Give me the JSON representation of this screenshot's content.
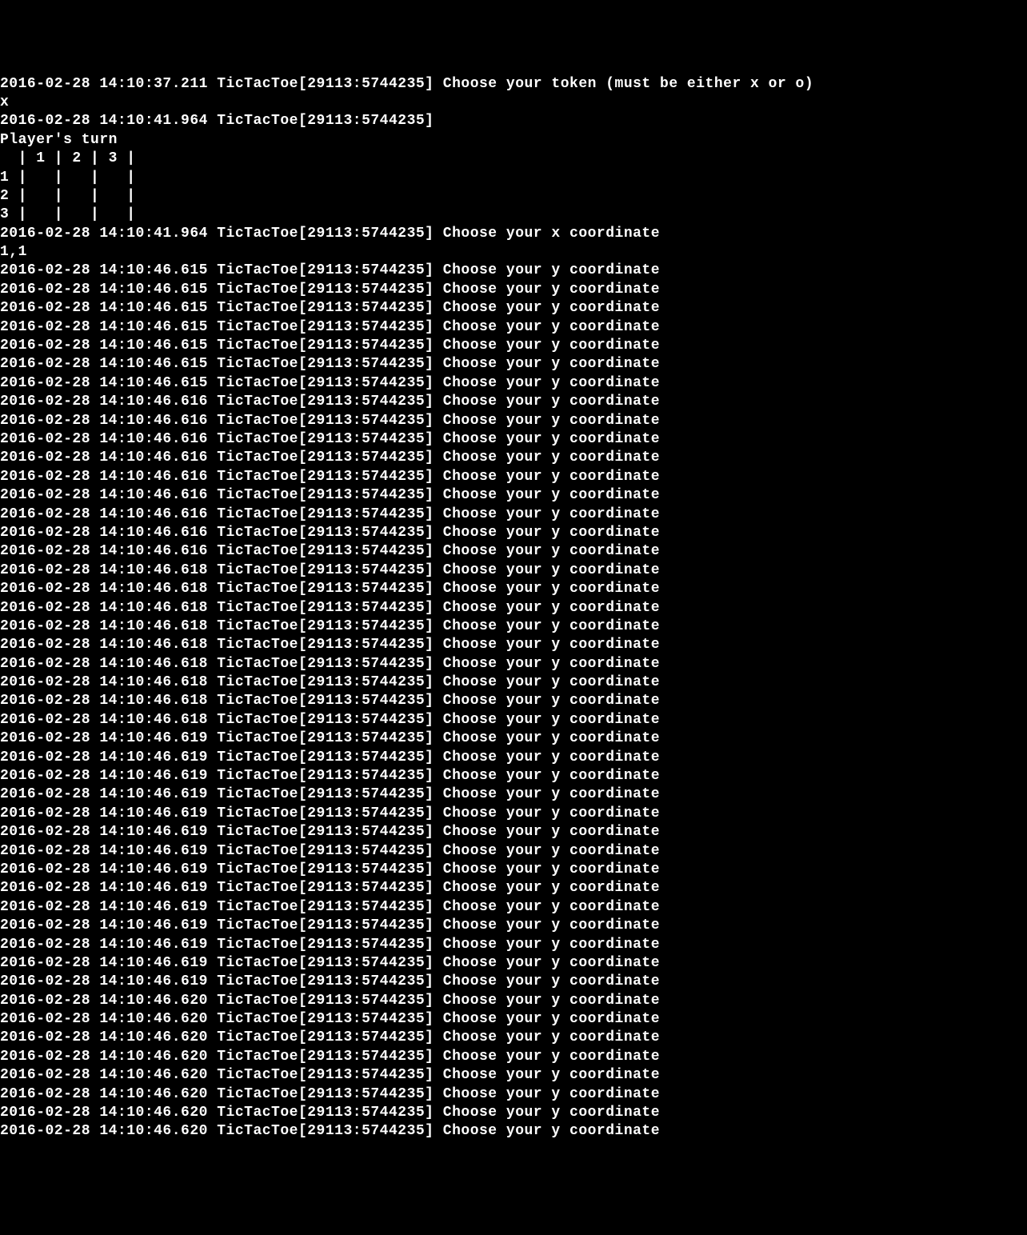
{
  "lines": [
    "2016-02-28 14:10:37.211 TicTacToe[29113:5744235] Choose your token (must be either x or o)",
    "x",
    "2016-02-28 14:10:41.964 TicTacToe[29113:5744235] ",
    "Player's turn",
    "  | 1 | 2 | 3 |",
    "1 |   |   |   |",
    "2 |   |   |   |",
    "3 |   |   |   |",
    "2016-02-28 14:10:41.964 TicTacToe[29113:5744235] Choose your x coordinate",
    "1,1",
    "2016-02-28 14:10:46.615 TicTacToe[29113:5744235] Choose your y coordinate",
    "2016-02-28 14:10:46.615 TicTacToe[29113:5744235] Choose your y coordinate",
    "2016-02-28 14:10:46.615 TicTacToe[29113:5744235] Choose your y coordinate",
    "2016-02-28 14:10:46.615 TicTacToe[29113:5744235] Choose your y coordinate",
    "2016-02-28 14:10:46.615 TicTacToe[29113:5744235] Choose your y coordinate",
    "2016-02-28 14:10:46.615 TicTacToe[29113:5744235] Choose your y coordinate",
    "2016-02-28 14:10:46.615 TicTacToe[29113:5744235] Choose your y coordinate",
    "2016-02-28 14:10:46.616 TicTacToe[29113:5744235] Choose your y coordinate",
    "2016-02-28 14:10:46.616 TicTacToe[29113:5744235] Choose your y coordinate",
    "2016-02-28 14:10:46.616 TicTacToe[29113:5744235] Choose your y coordinate",
    "2016-02-28 14:10:46.616 TicTacToe[29113:5744235] Choose your y coordinate",
    "2016-02-28 14:10:46.616 TicTacToe[29113:5744235] Choose your y coordinate",
    "2016-02-28 14:10:46.616 TicTacToe[29113:5744235] Choose your y coordinate",
    "2016-02-28 14:10:46.616 TicTacToe[29113:5744235] Choose your y coordinate",
    "2016-02-28 14:10:46.616 TicTacToe[29113:5744235] Choose your y coordinate",
    "2016-02-28 14:10:46.616 TicTacToe[29113:5744235] Choose your y coordinate",
    "2016-02-28 14:10:46.618 TicTacToe[29113:5744235] Choose your y coordinate",
    "2016-02-28 14:10:46.618 TicTacToe[29113:5744235] Choose your y coordinate",
    "2016-02-28 14:10:46.618 TicTacToe[29113:5744235] Choose your y coordinate",
    "2016-02-28 14:10:46.618 TicTacToe[29113:5744235] Choose your y coordinate",
    "2016-02-28 14:10:46.618 TicTacToe[29113:5744235] Choose your y coordinate",
    "2016-02-28 14:10:46.618 TicTacToe[29113:5744235] Choose your y coordinate",
    "2016-02-28 14:10:46.618 TicTacToe[29113:5744235] Choose your y coordinate",
    "2016-02-28 14:10:46.618 TicTacToe[29113:5744235] Choose your y coordinate",
    "2016-02-28 14:10:46.618 TicTacToe[29113:5744235] Choose your y coordinate",
    "2016-02-28 14:10:46.619 TicTacToe[29113:5744235] Choose your y coordinate",
    "2016-02-28 14:10:46.619 TicTacToe[29113:5744235] Choose your y coordinate",
    "2016-02-28 14:10:46.619 TicTacToe[29113:5744235] Choose your y coordinate",
    "2016-02-28 14:10:46.619 TicTacToe[29113:5744235] Choose your y coordinate",
    "2016-02-28 14:10:46.619 TicTacToe[29113:5744235] Choose your y coordinate",
    "2016-02-28 14:10:46.619 TicTacToe[29113:5744235] Choose your y coordinate",
    "2016-02-28 14:10:46.619 TicTacToe[29113:5744235] Choose your y coordinate",
    "2016-02-28 14:10:46.619 TicTacToe[29113:5744235] Choose your y coordinate",
    "2016-02-28 14:10:46.619 TicTacToe[29113:5744235] Choose your y coordinate",
    "2016-02-28 14:10:46.619 TicTacToe[29113:5744235] Choose your y coordinate",
    "2016-02-28 14:10:46.619 TicTacToe[29113:5744235] Choose your y coordinate",
    "2016-02-28 14:10:46.619 TicTacToe[29113:5744235] Choose your y coordinate",
    "2016-02-28 14:10:46.619 TicTacToe[29113:5744235] Choose your y coordinate",
    "2016-02-28 14:10:46.619 TicTacToe[29113:5744235] Choose your y coordinate",
    "2016-02-28 14:10:46.620 TicTacToe[29113:5744235] Choose your y coordinate",
    "2016-02-28 14:10:46.620 TicTacToe[29113:5744235] Choose your y coordinate",
    "2016-02-28 14:10:46.620 TicTacToe[29113:5744235] Choose your y coordinate",
    "2016-02-28 14:10:46.620 TicTacToe[29113:5744235] Choose your y coordinate",
    "2016-02-28 14:10:46.620 TicTacToe[29113:5744235] Choose your y coordinate",
    "2016-02-28 14:10:46.620 TicTacToe[29113:5744235] Choose your y coordinate",
    "2016-02-28 14:10:46.620 TicTacToe[29113:5744235] Choose your y coordinate",
    "2016-02-28 14:10:46.620 TicTacToe[29113:5744235] Choose your y coordinate"
  ]
}
